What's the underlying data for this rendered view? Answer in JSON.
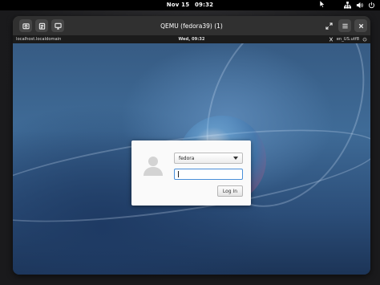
{
  "host_topbar": {
    "date": "Nov 15",
    "time": "09:32",
    "tray_icons": [
      "network-icon",
      "volume-icon",
      "power-icon"
    ]
  },
  "window": {
    "title": "QEMU (fedora39) (1)",
    "left_buttons": [
      "screenshot-icon",
      "clipboard-icon",
      "display-icon"
    ],
    "right_buttons": [
      "fullscreen-icon",
      "menu-icon",
      "close-icon"
    ]
  },
  "guest_bar": {
    "hostname": "localhost.localdomain",
    "datetime": "Wed, 09:32",
    "locale": "en_US.utf8"
  },
  "login": {
    "user": "fedora",
    "password_value": "",
    "login_label": "Log In"
  },
  "colors": {
    "focus_ring": "#4a90d9",
    "dialog_bg": "#fafafa",
    "host_bar": "#000000"
  }
}
